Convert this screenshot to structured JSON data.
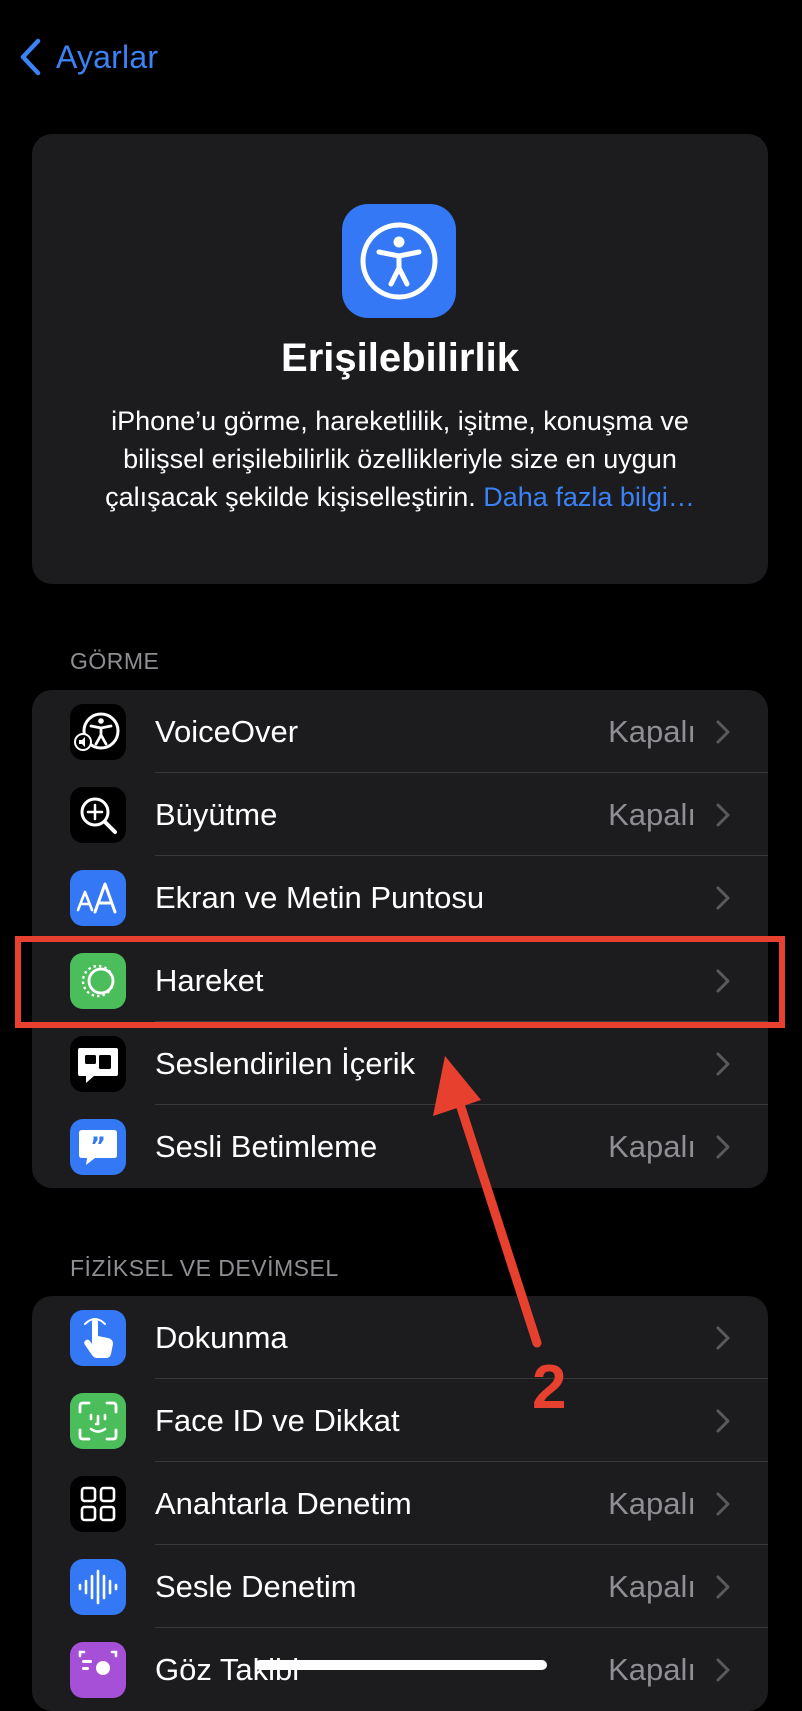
{
  "nav": {
    "back_label": "Ayarlar"
  },
  "hero": {
    "title": "Erişilebilirlik",
    "description": "iPhone’u görme, hareketlilik, işitme, konuşma ve bilişsel erişilebilirlik özellikleriyle size en uygun çalışacak şekilde kişiselleştirin.",
    "link_text": "Daha fazla bilgi…",
    "icon": "accessibility-icon",
    "icon_color": "#3478f6"
  },
  "sections": {
    "vision": {
      "header": "GÖRME",
      "items": [
        {
          "label": "VoiceOver",
          "value": "Kapalı",
          "icon": "voiceover-icon",
          "icon_bg": "#000000"
        },
        {
          "label": "Büyütme",
          "value": "Kapalı",
          "icon": "zoom-icon",
          "icon_bg": "#000000"
        },
        {
          "label": "Ekran ve Metin Puntosu",
          "value": "",
          "icon": "text-size-icon",
          "icon_bg": "#3478f6"
        },
        {
          "label": "Hareket",
          "value": "",
          "icon": "motion-icon",
          "icon_bg": "#4cbd5b"
        },
        {
          "label": "Seslendirilen İçerik",
          "value": "",
          "icon": "spoken-content-icon",
          "icon_bg": "#000000"
        },
        {
          "label": "Sesli Betimleme",
          "value": "Kapalı",
          "icon": "audio-description-icon",
          "icon_bg": "#3478f6"
        }
      ]
    },
    "physical": {
      "header": "FİZİKSEL VE DEVİMSEL",
      "items": [
        {
          "label": "Dokunma",
          "value": "",
          "icon": "touch-icon",
          "icon_bg": "#3478f6"
        },
        {
          "label": "Face ID ve Dikkat",
          "value": "",
          "icon": "face-id-icon",
          "icon_bg": "#4cbd5b"
        },
        {
          "label": "Anahtarla Denetim",
          "value": "Kapalı",
          "icon": "switch-control-icon",
          "icon_bg": "#000000"
        },
        {
          "label": "Sesle Denetim",
          "value": "Kapalı",
          "icon": "voice-control-icon",
          "icon_bg": "#3478f6"
        },
        {
          "label": "Göz Takibi",
          "value": "Kapalı",
          "icon": "eye-tracking-icon",
          "icon_bg": "#a550d6"
        }
      ]
    }
  },
  "annotation": {
    "step_number": "2",
    "color": "#e8402f"
  }
}
